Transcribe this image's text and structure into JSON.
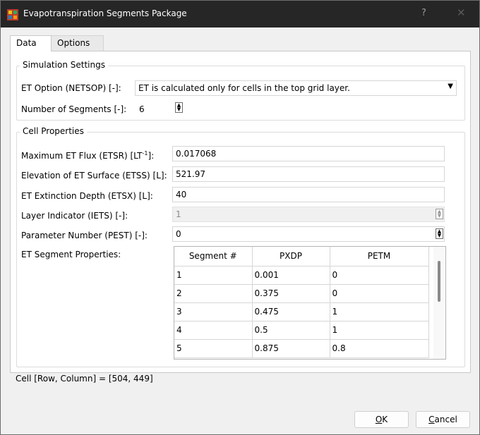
{
  "window": {
    "title": "Evapotranspiration Segments Package",
    "help_label": "?",
    "close_label": "✕"
  },
  "tabs": [
    {
      "label": "Data",
      "selected": true
    },
    {
      "label": "Options",
      "selected": false
    }
  ],
  "simulation_settings": {
    "title": "Simulation Settings",
    "et_option_label": "ET Option (NETSOP) [-]:",
    "et_option_value": "ET is calculated only for cells in the top grid layer.",
    "num_segments_label": "Number of Segments [-]:",
    "num_segments_value": "6"
  },
  "cell_properties": {
    "title": "Cell Properties",
    "etsr_label_pre": "Maximum ET Flux (ETSR) [LT",
    "etsr_label_sup": "-1",
    "etsr_label_post": "]:",
    "etsr_value": "0.017068",
    "etss_label": "Elevation of ET Surface (ETSS) [L]:",
    "etss_value": "521.97",
    "etsx_label": "ET Extinction Depth (ETSX) [L]:",
    "etsx_value": "40",
    "iets_label": "Layer Indicator (IETS) [-]:",
    "iets_value": "1",
    "pest_label": "Parameter Number (PEST) [-]:",
    "pest_value": "0",
    "segments_label": "ET Segment Properties:",
    "segment_table": {
      "headers": [
        "Segment #",
        "PXDP",
        "PETM"
      ],
      "rows": [
        [
          "1",
          "0.001",
          "0"
        ],
        [
          "2",
          "0.375",
          "0"
        ],
        [
          "3",
          "0.475",
          "1"
        ],
        [
          "4",
          "0.5",
          "1"
        ],
        [
          "5",
          "0.875",
          "0.8"
        ]
      ]
    }
  },
  "status": {
    "text": "Cell [Row, Column] = [504, 449]"
  },
  "buttons": {
    "ok_mnemonic": "O",
    "ok_rest": "K",
    "cancel_mnemonic": "C",
    "cancel_rest": "ancel"
  },
  "colors": {
    "titlebar": "#262626",
    "dialog": "#f0f0f0",
    "panel": "#ffffff"
  }
}
